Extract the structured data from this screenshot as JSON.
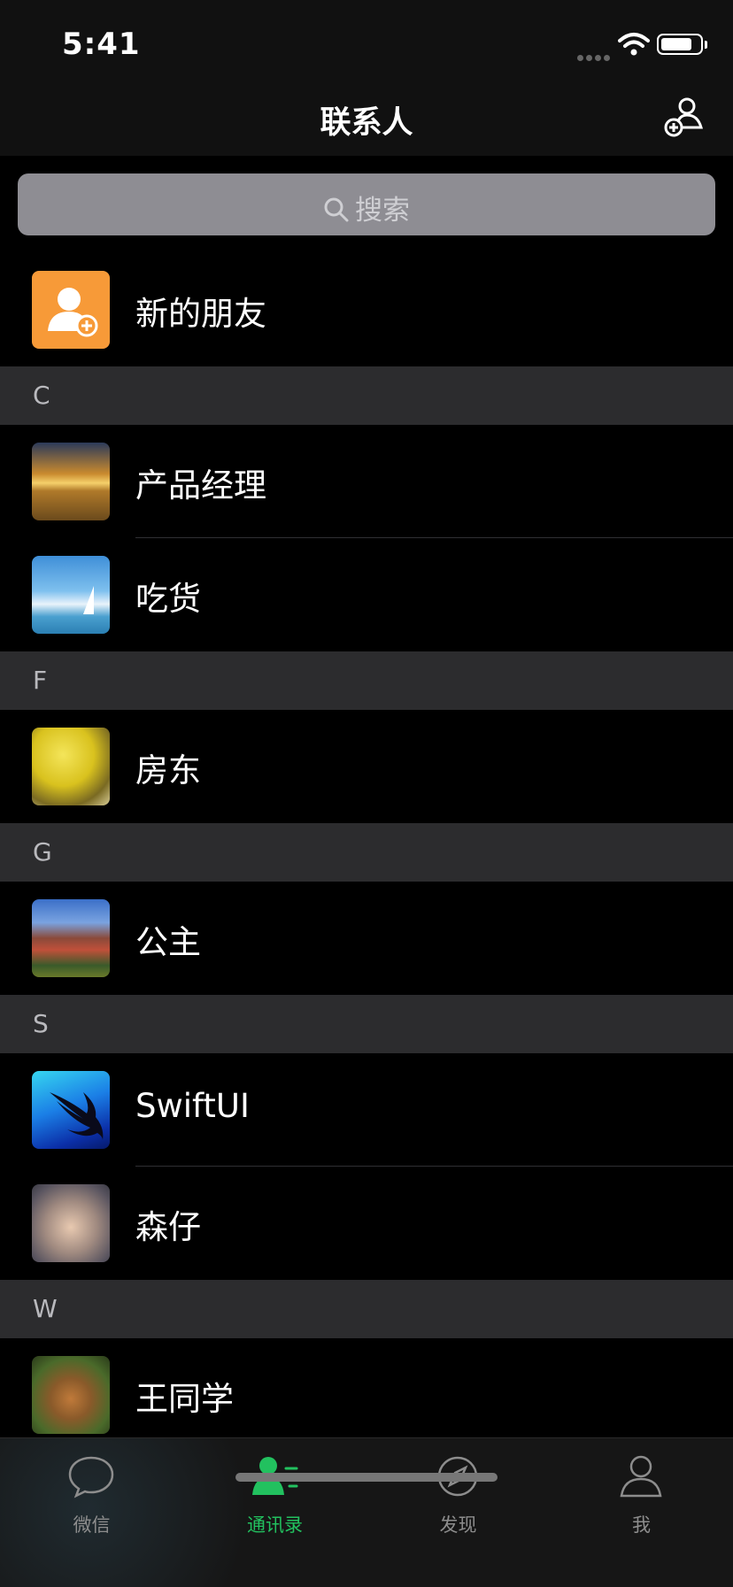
{
  "status": {
    "time": "5:41"
  },
  "nav": {
    "title": "联系人"
  },
  "search": {
    "placeholder": "搜索"
  },
  "new_friends": {
    "label": "新的朋友"
  },
  "sections": [
    {
      "letter": "C",
      "contacts": [
        {
          "name": "产品经理",
          "avatar": "wheat-field-sunset"
        },
        {
          "name": "吃货",
          "avatar": "sailboat-sky"
        }
      ]
    },
    {
      "letter": "F",
      "contacts": [
        {
          "name": "房东",
          "avatar": "yellow-umbrella"
        }
      ]
    },
    {
      "letter": "G",
      "contacts": [
        {
          "name": "公主",
          "avatar": "castle-house"
        }
      ]
    },
    {
      "letter": "S",
      "contacts": [
        {
          "name": "SwiftUI",
          "avatar": "swift-logo"
        },
        {
          "name": "森仔",
          "avatar": "detective-cartoon"
        }
      ]
    },
    {
      "letter": "W",
      "contacts": [
        {
          "name": "王同学",
          "avatar": "squirrel"
        }
      ]
    }
  ],
  "tabs": [
    {
      "label": "微信",
      "icon": "chat-bubble-icon",
      "active": false
    },
    {
      "label": "通讯录",
      "icon": "contacts-icon",
      "active": true
    },
    {
      "label": "发现",
      "icon": "compass-icon",
      "active": false
    },
    {
      "label": "我",
      "icon": "person-icon",
      "active": false
    }
  ],
  "colors": {
    "accent": "#22c15f",
    "new_friend_orange": "#f79a38"
  }
}
